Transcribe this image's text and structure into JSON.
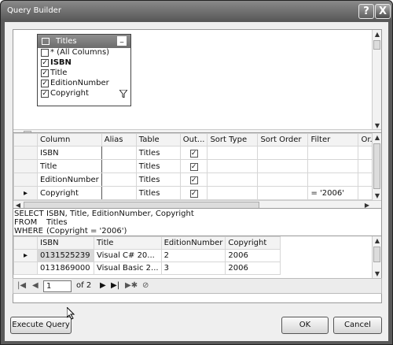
{
  "window": {
    "title": "Query Builder",
    "help_label": "?",
    "close_label": "X"
  },
  "diagram": {
    "table_name": "Titles",
    "minimize_label": "_",
    "columns": [
      {
        "label": "* (All Columns)",
        "checked": false
      },
      {
        "label": "ISBN",
        "checked": true
      },
      {
        "label": "Title",
        "checked": true
      },
      {
        "label": "EditionNumber",
        "checked": true
      },
      {
        "label": "Copyright",
        "checked": true
      }
    ]
  },
  "criteria": {
    "headers": [
      "Column",
      "Alias",
      "Table",
      "Out...",
      "Sort Type",
      "Sort Order",
      "Filter",
      "Or..."
    ],
    "rows": [
      {
        "column": "ISBN",
        "alias": "",
        "table": "Titles",
        "output": true,
        "sort_type": "",
        "sort_order": "",
        "filter": ""
      },
      {
        "column": "Title",
        "alias": "",
        "table": "Titles",
        "output": true,
        "sort_type": "",
        "sort_order": "",
        "filter": ""
      },
      {
        "column": "EditionNumber",
        "alias": "",
        "table": "Titles",
        "output": true,
        "sort_type": "",
        "sort_order": "",
        "filter": ""
      },
      {
        "column": "Copyright",
        "alias": "",
        "table": "Titles",
        "output": true,
        "sort_type": "",
        "sort_order": "",
        "filter": "= '2006'"
      }
    ]
  },
  "sql": {
    "select_kw": "SELECT",
    "select_val": "ISBN, Title, EditionNumber, Copyright",
    "from_kw": "FROM",
    "from_val": "Titles",
    "where_kw": "WHERE",
    "where_val": "(Copyright = '2006')"
  },
  "results": {
    "headers": [
      "ISBN",
      "Title",
      "EditionNumber",
      "Copyright"
    ],
    "rows": [
      [
        "0131525239",
        "Visual C# 20...",
        "2",
        "2006"
      ],
      [
        "0131869000",
        "Visual Basic 2...",
        "3",
        "2006"
      ]
    ]
  },
  "navigator": {
    "page": "1",
    "of_label": "of 2"
  },
  "buttons": {
    "execute": "Execute Query",
    "ok": "OK",
    "cancel": "Cancel"
  }
}
